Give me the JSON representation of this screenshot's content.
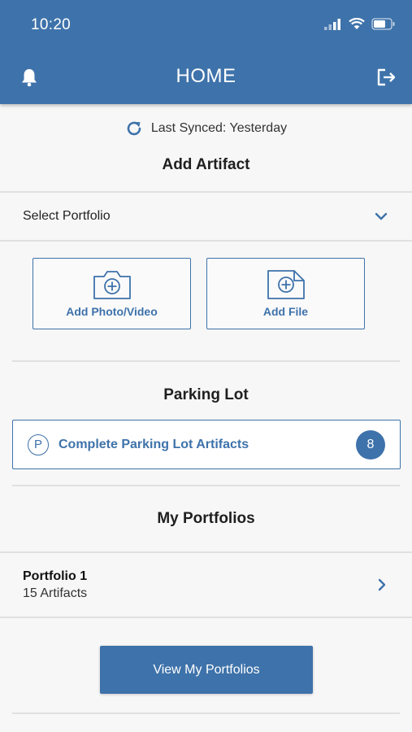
{
  "status_bar": {
    "time": "10:20",
    "icons": [
      "cellular-signal-icon",
      "wifi-icon",
      "battery-icon"
    ]
  },
  "header": {
    "title": "HOME",
    "left_icon": "bell-icon",
    "right_icon": "logout-icon"
  },
  "sync": {
    "icon": "refresh-icon",
    "text": "Last Synced: Yesterday"
  },
  "add_artifact": {
    "title": "Add Artifact",
    "select_portfolio": {
      "value": "Select Portfolio",
      "icon": "chevron-down-icon"
    },
    "tiles": [
      {
        "label": "Add Photo/Video",
        "icon": "camera-plus-icon"
      },
      {
        "label": "Add File",
        "icon": "file-plus-icon"
      }
    ]
  },
  "parking_lot": {
    "title": "Parking Lot",
    "button_label": "Complete Parking Lot Artifacts",
    "icon_letter": "P",
    "count": "8"
  },
  "my_portfolios": {
    "title": "My Portfolios",
    "items": [
      {
        "name": "Portfolio 1",
        "count": "15 Artifacts"
      }
    ],
    "view_button_label": "View My Portfolios"
  },
  "colors": {
    "primary": "#3e72aa",
    "background": "#f7f7f7",
    "divider": "#e0e0e0"
  }
}
